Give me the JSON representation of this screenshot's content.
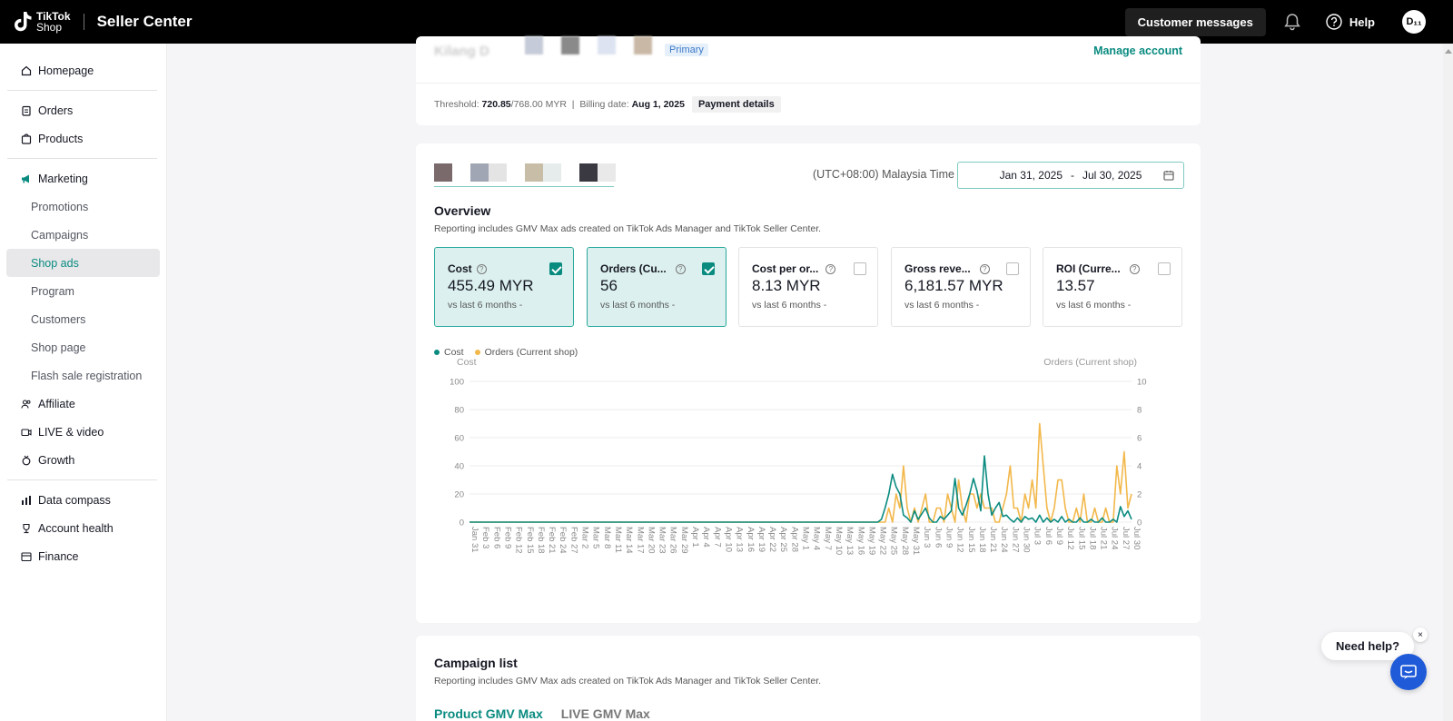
{
  "topbar": {
    "brand_line1": "TikTok",
    "brand_line2": "Shop",
    "app_title": "Seller Center",
    "customer_messages": "Customer messages",
    "help": "Help",
    "avatar_initials": "D₁₁"
  },
  "sidebar": {
    "homepage": "Homepage",
    "orders": "Orders",
    "products": "Products",
    "marketing": "Marketing",
    "promotions": "Promotions",
    "campaigns": "Campaigns",
    "shop_ads": "Shop ads",
    "program": "Program",
    "customers": "Customers",
    "shop_page": "Shop page",
    "flash_sale": "Flash sale registration",
    "affiliate": "Affiliate",
    "live_video": "LIVE & video",
    "growth": "Growth",
    "data_compass": "Data compass",
    "account_health": "Account health",
    "finance": "Finance"
  },
  "account": {
    "name": "Kilang D",
    "badge": "Primary",
    "manage": "Manage account",
    "threshold_label": "Threshold:",
    "threshold_used": "720.85",
    "threshold_total": "/768.00 MYR",
    "separator": "|",
    "billing_label": "Billing date:",
    "billing_date": "Aug 1, 2025",
    "payment_details": "Payment details"
  },
  "overview": {
    "timezone": "(UTC+08:00) Malaysia Time",
    "date_start": "Jan 31, 2025",
    "date_dash": "-",
    "date_end": "Jul 30, 2025",
    "title": "Overview",
    "description": "Reporting includes GMV Max ads created on TikTok Ads Manager and TikTok Seller Center.",
    "metrics": [
      {
        "label": "Cost",
        "value": "455.49 MYR",
        "compare": "vs last 6 months -",
        "checked": true
      },
      {
        "label": "Orders (Cu...",
        "value": "56",
        "compare": "vs last 6 months -",
        "checked": true
      },
      {
        "label": "Cost per or...",
        "value": "8.13 MYR",
        "compare": "vs last 6 months -",
        "checked": false
      },
      {
        "label": "Gross reve...",
        "value": "6,181.57 MYR",
        "compare": "vs last 6 months -",
        "checked": false
      },
      {
        "label": "ROI (Curre...",
        "value": "13.57",
        "compare": "vs last 6 months -",
        "checked": false
      }
    ]
  },
  "campaign": {
    "title": "Campaign list",
    "description": "Reporting includes GMV Max ads created on TikTok Ads Manager and TikTok Seller Center.",
    "tab_product": "Product GMV Max",
    "tab_live": "LIVE GMV Max"
  },
  "help_widget": {
    "label": "Need help?",
    "close": "×"
  },
  "colors": {
    "accent": "#0a8b80",
    "cost_series": "#0a8b80",
    "orders_series": "#f2b84b"
  },
  "chart_data": {
    "type": "line",
    "legend": [
      "Cost",
      "Orders (Current shop)"
    ],
    "ylabel_left": "Cost",
    "ylabel_right": "Orders (Current shop)",
    "ylim_left": [
      0,
      100
    ],
    "ylim_right": [
      0,
      10
    ],
    "yticks_left": [
      "100",
      "80",
      "60",
      "40",
      "20",
      "0"
    ],
    "yticks_right": [
      "10",
      "8",
      "6",
      "4",
      "2",
      "0"
    ],
    "x_tick_labels": [
      "Jan 31",
      "Feb 3",
      "Feb 6",
      "Feb 9",
      "Feb 12",
      "Feb 15",
      "Feb 18",
      "Feb 21",
      "Feb 24",
      "Feb 27",
      "Mar 2",
      "Mar 5",
      "Mar 8",
      "Mar 11",
      "Mar 14",
      "Mar 17",
      "Mar 20",
      "Mar 23",
      "Mar 26",
      "Mar 29",
      "Apr 1",
      "Apr 4",
      "Apr 7",
      "Apr 10",
      "Apr 13",
      "Apr 16",
      "Apr 19",
      "Apr 22",
      "Apr 25",
      "Apr 28",
      "May 1",
      "May 4",
      "May 7",
      "May 10",
      "May 13",
      "May 16",
      "May 19",
      "May 22",
      "May 25",
      "May 28",
      "May 31",
      "Jun 3",
      "Jun 6",
      "Jun 9",
      "Jun 12",
      "Jun 15",
      "Jun 18",
      "Jun 21",
      "Jun 24",
      "Jun 27",
      "Jun 30",
      "Jul 3",
      "Jul 6",
      "Jul 9",
      "Jul 12",
      "Jul 15",
      "Jul 18",
      "Jul 21",
      "Jul 24",
      "Jul 27",
      "Jul 30"
    ],
    "series": [
      {
        "name": "Cost",
        "axis": "left",
        "nonzero_points": [
          {
            "x": "May 23",
            "y": 2
          },
          {
            "x": "May 24",
            "y": 10
          },
          {
            "x": "May 25",
            "y": 20
          },
          {
            "x": "May 26",
            "y": 34
          },
          {
            "x": "May 27",
            "y": 25
          },
          {
            "x": "May 28",
            "y": 20
          },
          {
            "x": "May 29",
            "y": 5
          },
          {
            "x": "May 30",
            "y": 3
          },
          {
            "x": "Jun 1",
            "y": 8
          },
          {
            "x": "Jun 2",
            "y": 2
          },
          {
            "x": "Jun 3",
            "y": 6
          },
          {
            "x": "Jun 4",
            "y": 10
          },
          {
            "x": "Jun 5",
            "y": 3
          },
          {
            "x": "Jun 8",
            "y": 4
          },
          {
            "x": "Jun 9",
            "y": 2
          },
          {
            "x": "Jun 10",
            "y": 5
          },
          {
            "x": "Jun 11",
            "y": 8
          },
          {
            "x": "Jun 12",
            "y": 31
          },
          {
            "x": "Jun 13",
            "y": 10
          },
          {
            "x": "Jun 14",
            "y": 5
          },
          {
            "x": "Jun 15",
            "y": 12
          },
          {
            "x": "Jun 16",
            "y": 20
          },
          {
            "x": "Jun 17",
            "y": 31
          },
          {
            "x": "Jun 18",
            "y": 22
          },
          {
            "x": "Jun 19",
            "y": 8
          },
          {
            "x": "Jun 20",
            "y": 47
          },
          {
            "x": "Jun 21",
            "y": 20
          },
          {
            "x": "Jun 22",
            "y": 5
          },
          {
            "x": "Jun 23",
            "y": 10
          },
          {
            "x": "Jun 24",
            "y": 14
          },
          {
            "x": "Jun 25",
            "y": 4
          },
          {
            "x": "Jun 26",
            "y": 5
          },
          {
            "x": "Jun 27",
            "y": 2
          },
          {
            "x": "Jun 29",
            "y": 3
          },
          {
            "x": "Jul 1",
            "y": 4
          },
          {
            "x": "Jul 2",
            "y": 2
          },
          {
            "x": "Jul 3",
            "y": 3
          },
          {
            "x": "Jul 5",
            "y": 5
          },
          {
            "x": "Jul 7",
            "y": 3
          },
          {
            "x": "Jul 9",
            "y": 2
          },
          {
            "x": "Jul 11",
            "y": 4
          },
          {
            "x": "Jul 13",
            "y": 2
          },
          {
            "x": "Jul 16",
            "y": 3
          },
          {
            "x": "Jul 19",
            "y": 2
          },
          {
            "x": "Jul 22",
            "y": 3
          },
          {
            "x": "Jul 25",
            "y": 2
          },
          {
            "x": "Jul 27",
            "y": 11
          },
          {
            "x": "Jul 28",
            "y": 4
          },
          {
            "x": "Jul 29",
            "y": 8
          },
          {
            "x": "Jul 30",
            "y": 2
          }
        ]
      },
      {
        "name": "Orders (Current shop)",
        "axis": "right",
        "nonzero_points": [
          {
            "x": "May 25",
            "y": 1
          },
          {
            "x": "May 27",
            "y": 2
          },
          {
            "x": "May 28",
            "y": 1
          },
          {
            "x": "May 29",
            "y": 4
          },
          {
            "x": "May 30",
            "y": 1
          },
          {
            "x": "Jun 1",
            "y": 1
          },
          {
            "x": "Jun 3",
            "y": 1
          },
          {
            "x": "Jun 4",
            "y": 2
          },
          {
            "x": "Jun 7",
            "y": 1
          },
          {
            "x": "Jun 8",
            "y": 1
          },
          {
            "x": "Jun 10",
            "y": 2
          },
          {
            "x": "Jun 11",
            "y": 1
          },
          {
            "x": "Jun 13",
            "y": 3
          },
          {
            "x": "Jun 14",
            "y": 1
          },
          {
            "x": "Jun 16",
            "y": 2
          },
          {
            "x": "Jun 17",
            "y": 2
          },
          {
            "x": "Jun 18",
            "y": 1
          },
          {
            "x": "Jun 19",
            "y": 2
          },
          {
            "x": "Jun 20",
            "y": 1
          },
          {
            "x": "Jun 21",
            "y": 1
          },
          {
            "x": "Jun 22",
            "y": 1
          },
          {
            "x": "Jun 25",
            "y": 1
          },
          {
            "x": "Jun 26",
            "y": 2
          },
          {
            "x": "Jun 27",
            "y": 4
          },
          {
            "x": "Jun 28",
            "y": 1
          },
          {
            "x": "Jun 29",
            "y": 1
          },
          {
            "x": "Jul 1",
            "y": 2
          },
          {
            "x": "Jul 2",
            "y": 1
          },
          {
            "x": "Jul 3",
            "y": 3
          },
          {
            "x": "Jul 4",
            "y": 1
          },
          {
            "x": "Jul 5",
            "y": 7
          },
          {
            "x": "Jul 6",
            "y": 4
          },
          {
            "x": "Jul 7",
            "y": 1
          },
          {
            "x": "Jul 9",
            "y": 1
          },
          {
            "x": "Jul 10",
            "y": 3
          },
          {
            "x": "Jul 11",
            "y": 3
          },
          {
            "x": "Jul 12",
            "y": 1
          },
          {
            "x": "Jul 15",
            "y": 1
          },
          {
            "x": "Jul 17",
            "y": 2
          },
          {
            "x": "Jul 20",
            "y": 1
          },
          {
            "x": "Jul 23",
            "y": 1
          },
          {
            "x": "Jul 26",
            "y": 4
          },
          {
            "x": "Jul 27",
            "y": 2
          },
          {
            "x": "Jul 28",
            "y": 5
          },
          {
            "x": "Jul 29",
            "y": 1
          },
          {
            "x": "Jul 30",
            "y": 2
          }
        ]
      }
    ]
  }
}
